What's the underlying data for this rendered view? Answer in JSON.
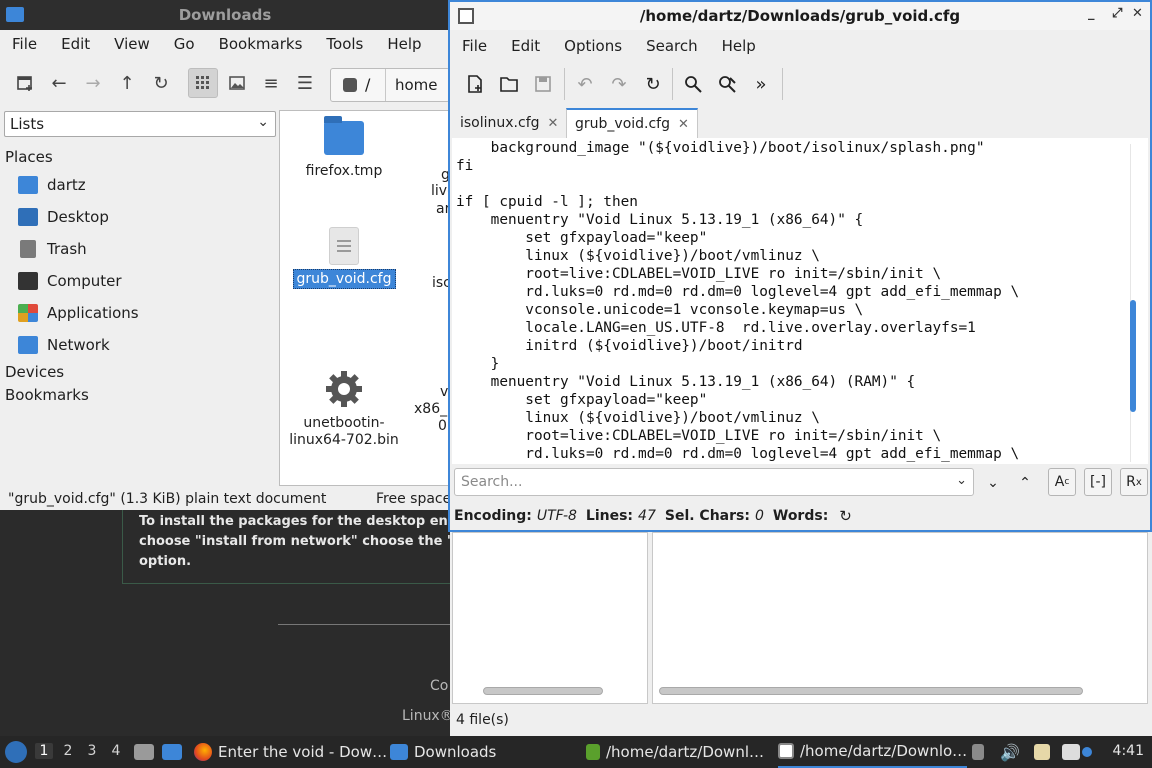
{
  "background_page": {
    "note_lines": [
      "To install the packages for the desktop enviror",
      "choose \"install from network\" choose the \"loca",
      "option."
    ],
    "fragment_1": "Co",
    "fragment_2": "Linux®"
  },
  "file_manager": {
    "title": "Downloads",
    "menu": [
      "File",
      "Edit",
      "View",
      "Go",
      "Bookmarks",
      "Tools",
      "Help"
    ],
    "path": {
      "root": "/",
      "segment": "home"
    },
    "side_pane_mode": "Lists",
    "places_heading": "Places",
    "places": [
      {
        "label": "dartz",
        "icon": "home-folder-icon",
        "color": "#3d86d8"
      },
      {
        "label": "Desktop",
        "icon": "desktop-icon",
        "color": "#2f6fb8"
      },
      {
        "label": "Trash",
        "icon": "trash-icon",
        "color": "#7a7a7a"
      },
      {
        "label": "Computer",
        "icon": "computer-icon",
        "color": "#333333"
      },
      {
        "label": "Applications",
        "icon": "applications-icon",
        "color": "#e0a020"
      },
      {
        "label": "Network",
        "icon": "network-icon",
        "color": "#3d86d8"
      }
    ],
    "devices_heading": "Devices",
    "bookmarks_heading": "Bookmarks",
    "files": [
      {
        "name": "firefox.tmp",
        "kind": "folder"
      },
      {
        "name": "grub_void.cfg",
        "kind": "text",
        "selected": true
      },
      {
        "name": "unetbootin-\nlinux64-702.bin",
        "kind": "executable"
      }
    ],
    "cut_labels": [
      "g",
      "live",
      "ar",
      "isc",
      "v",
      "x86_",
      "0"
    ],
    "status_left": "\"grub_void.cfg\" (1.3 KiB) plain text document",
    "status_right": "Free space",
    "lower_file_count": "4 file(s)"
  },
  "editor": {
    "title": "/home/dartz/Downloads/grub_void.cfg",
    "menu": [
      "File",
      "Edit",
      "Options",
      "Search",
      "Help"
    ],
    "tabs": [
      {
        "label": "isolinux.cfg",
        "active": false
      },
      {
        "label": "grub_void.cfg",
        "active": true
      }
    ],
    "code": "    background_image \"(${voidlive})/boot/isolinux/splash.png\"\nfi\n\nif [ cpuid -l ]; then\n    menuentry \"Void Linux 5.13.19_1 (x86_64)\" {\n        set gfxpayload=\"keep\"\n        linux (${voidlive})/boot/vmlinuz \\\n        root=live:CDLABEL=VOID_LIVE ro init=/sbin/init \\\n        rd.luks=0 rd.md=0 rd.dm=0 loglevel=4 gpt add_efi_memmap \\\n        vconsole.unicode=1 vconsole.keymap=us \\\n        locale.LANG=en_US.UTF-8  rd.live.overlay.overlayfs=1\n        initrd (${voidlive})/boot/initrd\n    }\n    menuentry \"Void Linux 5.13.19_1 (x86_64) (RAM)\" {\n        set gfxpayload=\"keep\"\n        linux (${voidlive})/boot/vmlinuz \\\n        root=live:CDLABEL=VOID_LIVE ro init=/sbin/init \\\n        rd.luks=0 rd.md=0 rd.dm=0 loglevel=4 gpt add_efi_memmap \\",
    "search_placeholder": "Search...",
    "status": {
      "encoding_label": "Encoding:",
      "encoding_value": "UTF-8",
      "lines_label": "Lines:",
      "lines_value": "47",
      "selchars_label": "Sel. Chars:",
      "selchars_value": "0",
      "words_label": "Words:"
    }
  },
  "taskbar": {
    "workspaces": [
      "1",
      "2",
      "3",
      "4"
    ],
    "active_workspace": "1",
    "tasks": [
      {
        "label": "Enter the void - Dow…",
        "icon": "firefox-icon"
      },
      {
        "label": "Downloads",
        "icon": "folder-icon"
      },
      {
        "label": "/home/dartz/Downl…",
        "icon": "archive-icon"
      },
      {
        "label": "/home/dartz/Downlo…",
        "icon": "text-editor-icon"
      }
    ],
    "clock": "4:41"
  }
}
